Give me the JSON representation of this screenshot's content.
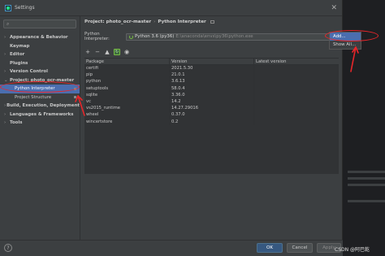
{
  "window": {
    "title": "Settings",
    "close_glyph": "✕"
  },
  "sidebar": {
    "search_placeholder": "",
    "items": [
      {
        "label": "Appearance & Behavior",
        "arrow": "›"
      },
      {
        "label": "Keymap",
        "arrow": ""
      },
      {
        "label": "Editor",
        "arrow": "›"
      },
      {
        "label": "Plugins",
        "arrow": ""
      },
      {
        "label": "Version Control",
        "arrow": "›"
      },
      {
        "label": "Project: photo_ocr-master",
        "arrow": "⌄"
      },
      {
        "label": "Python Interpreter",
        "arrow": ""
      },
      {
        "label": "Project Structure",
        "arrow": ""
      },
      {
        "label": "Build, Execution, Deployment",
        "arrow": "›"
      },
      {
        "label": "Languages & Frameworks",
        "arrow": "›"
      },
      {
        "label": "Tools",
        "arrow": "›"
      }
    ]
  },
  "breadcrumb": {
    "project": "Project: photo_ocr-master",
    "separator": "›",
    "page": "Python Interpreter"
  },
  "interpreter": {
    "label": "Python Interpreter:",
    "name": "Python 3.6 (py36)",
    "path": "E:\\anaconda\\envs\\py36\\python.exe"
  },
  "popup": {
    "items": [
      "Add...",
      "Show All..."
    ]
  },
  "toolbar": {
    "add": "+",
    "remove": "−",
    "upgrade": "▲",
    "refresh": "↻",
    "eye": "◉"
  },
  "table": {
    "headers": [
      "Package",
      "Version",
      "Latest version"
    ],
    "rows": [
      [
        "certifi",
        "2021.5.30",
        ""
      ],
      [
        "pip",
        "21.0.1",
        ""
      ],
      [
        "python",
        "3.6.13",
        ""
      ],
      [
        "setuptools",
        "58.0.4",
        ""
      ],
      [
        "sqlite",
        "3.36.0",
        ""
      ],
      [
        "vc",
        "14.2",
        ""
      ],
      [
        "vs2015_runtime",
        "14.27.29016",
        ""
      ],
      [
        "wheel",
        "0.37.0",
        ""
      ],
      [
        "wincertstore",
        "0.2",
        ""
      ]
    ]
  },
  "footer": {
    "help": "?",
    "ok": "OK",
    "cancel": "Cancel",
    "apply": "Apply"
  },
  "watermark": "CSDN @阿巴乾",
  "colors": {
    "selection": "#4b6eaf",
    "annotation_red": "#e8262a",
    "background": "#3c3f41"
  }
}
